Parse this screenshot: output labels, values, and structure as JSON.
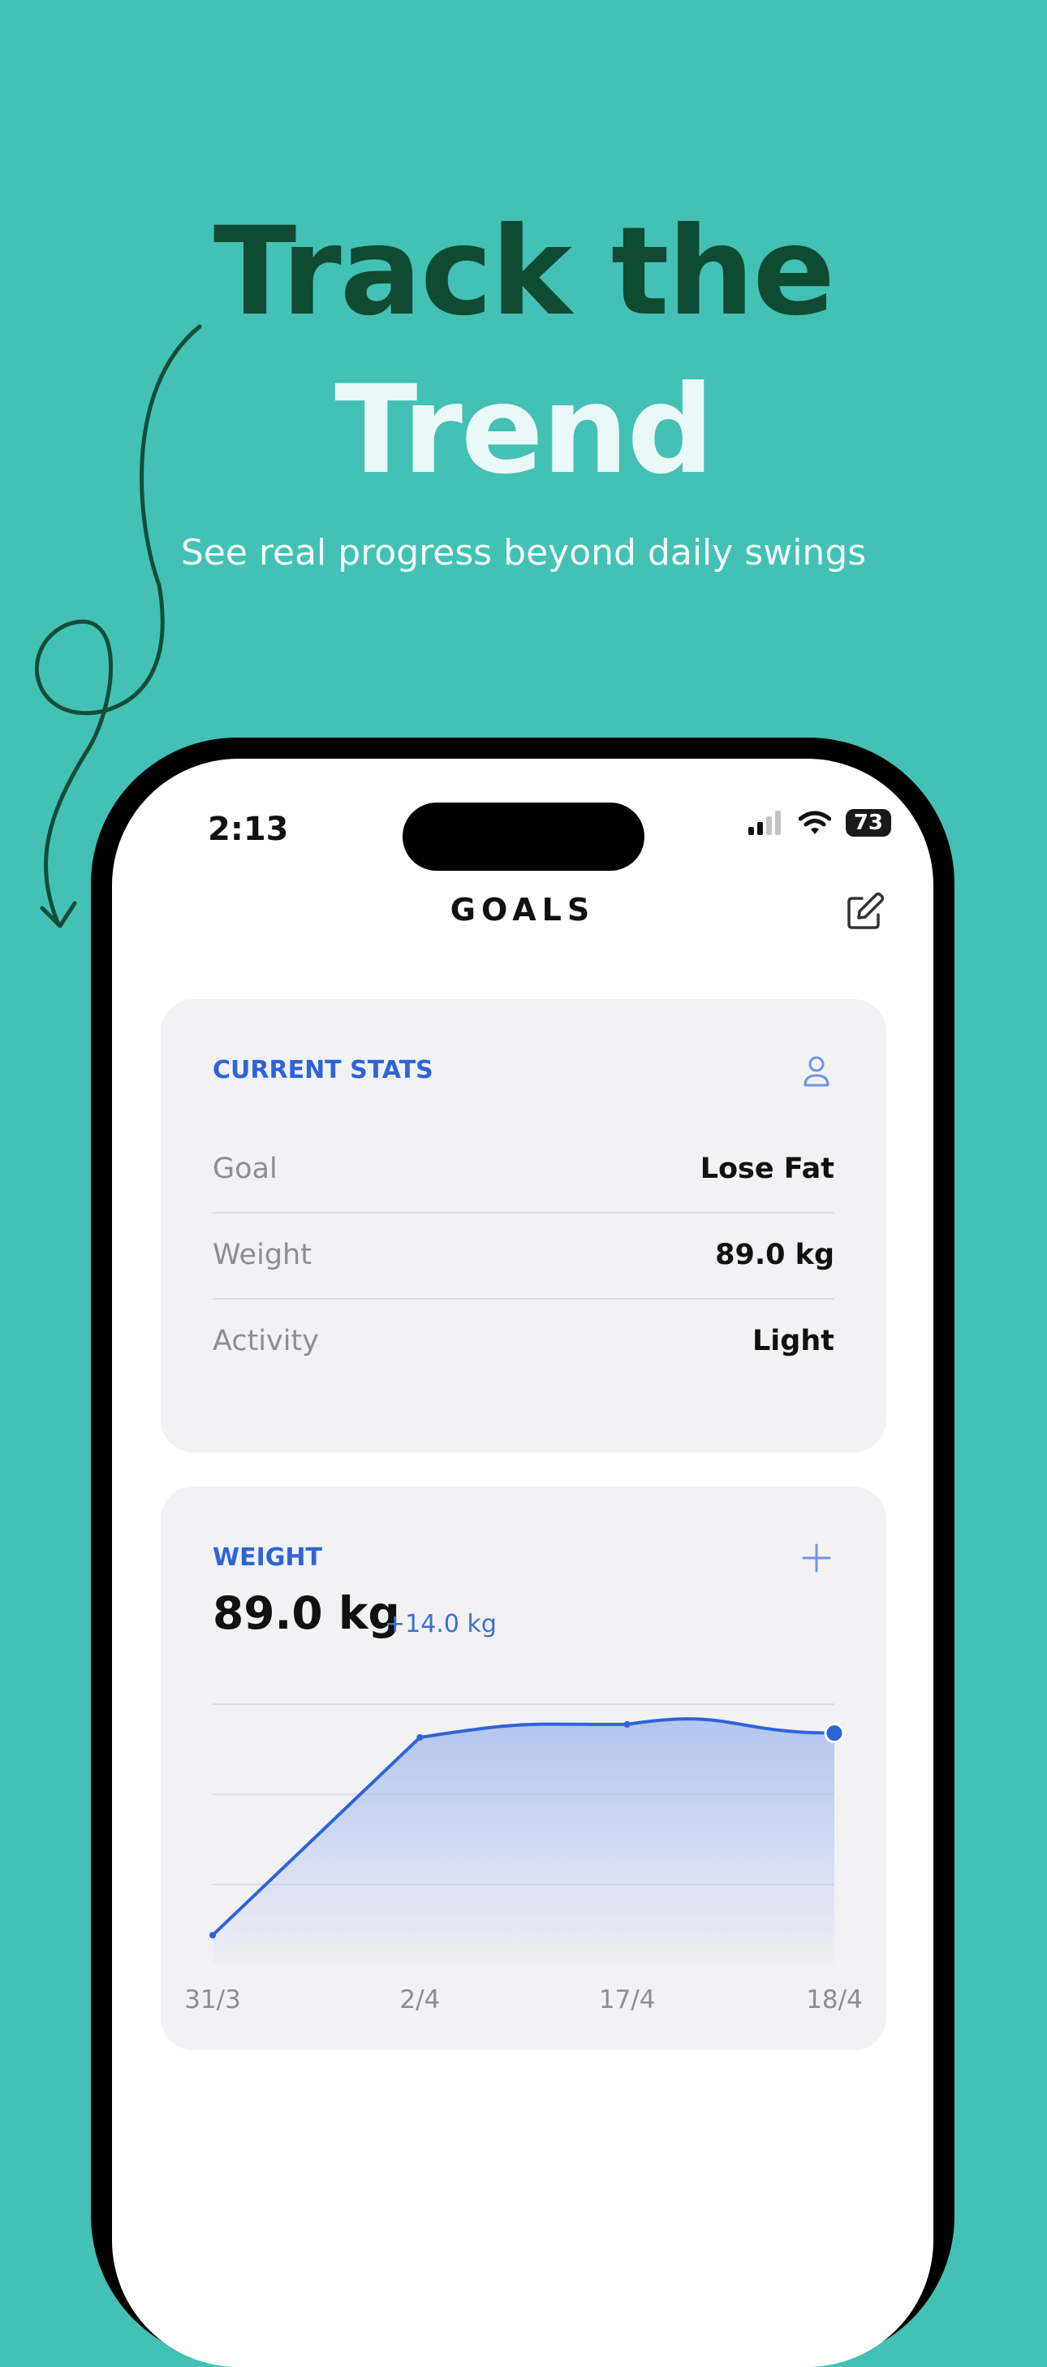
{
  "hero": {
    "title_line1": "Track the",
    "title_line2": "Trend",
    "subtitle": "See real progress beyond daily swings"
  },
  "status_bar": {
    "time": "2:13",
    "battery": "73"
  },
  "nav": {
    "title": "GOALS",
    "edit_icon": "edit-icon"
  },
  "current_stats": {
    "label": "CURRENT STATS",
    "icon": "person-icon",
    "rows": [
      {
        "key": "Goal",
        "value": "Lose Fat"
      },
      {
        "key": "Weight",
        "value": "89.0 kg"
      },
      {
        "key": "Activity",
        "value": "Light"
      }
    ]
  },
  "weight_card": {
    "label": "WEIGHT",
    "add_icon": "plus-icon",
    "current": "89.0 kg",
    "delta": "+14.0 kg"
  },
  "chart_data": {
    "type": "area",
    "categories": [
      "31/3",
      "2/4",
      "17/4",
      "18/4"
    ],
    "values": [
      75.0,
      88.7,
      89.6,
      89.0
    ],
    "ylim": [
      73,
      91
    ],
    "grid": true,
    "colors": {
      "line": "#2e64d6",
      "fill": "#a9bced"
    }
  },
  "colors": {
    "background": "#43c1b4",
    "headline_dark": "#0f4a33",
    "headline_light": "#eaf8f8",
    "accent": "#2e64d6"
  }
}
